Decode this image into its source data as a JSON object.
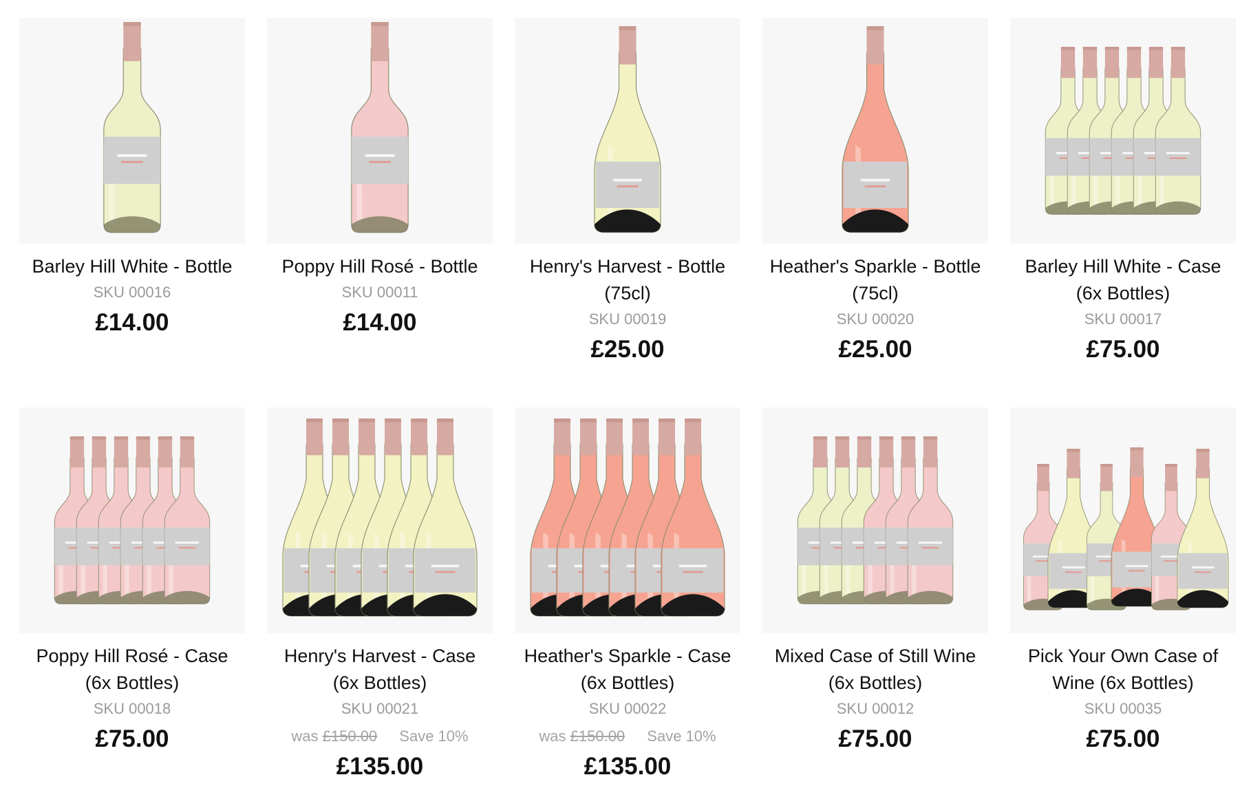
{
  "colors": {
    "white_wine": "#eef0c8",
    "rose_wine": "#f4c9c9",
    "sparkling_white": "#f2f2c2",
    "sparkling_rose": "#f6a491",
    "capsule": "#d6a9a2",
    "label": "#cfcfcf",
    "thumbnail_bg": "#f7f7f7",
    "sku_text": "#9a9a9a"
  },
  "products": [
    {
      "name": "Barley Hill White - Bottle",
      "sku": "SKU 00016",
      "price": "£14.00",
      "image": {
        "layout": "single",
        "style": "still",
        "wines": [
          "white"
        ]
      }
    },
    {
      "name": "Poppy Hill Rosé - Bottle",
      "sku": "SKU 00011",
      "price": "£14.00",
      "image": {
        "layout": "single",
        "style": "still",
        "wines": [
          "rose"
        ]
      }
    },
    {
      "name": "Henry's Harvest - Bottle (75cl)",
      "sku": "SKU 00019",
      "price": "£25.00",
      "image": {
        "layout": "single",
        "style": "sparkling",
        "wines": [
          "sparkling_white"
        ]
      }
    },
    {
      "name": "Heather's Sparkle - Bottle (75cl)",
      "sku": "SKU 00020",
      "price": "£25.00",
      "image": {
        "layout": "single",
        "style": "sparkling",
        "wines": [
          "sparkling_rose"
        ]
      }
    },
    {
      "name": "Barley Hill White - Case (6x Bottles)",
      "sku": "SKU 00017",
      "price": "£75.00",
      "image": {
        "layout": "row",
        "style": "still",
        "wines": [
          "white",
          "white",
          "white",
          "white",
          "white",
          "white"
        ]
      }
    },
    {
      "name": "Poppy Hill Rosé - Case (6x Bottles)",
      "sku": "SKU 00018",
      "price": "£75.00",
      "image": {
        "layout": "row",
        "style": "still",
        "wines": [
          "rose",
          "rose",
          "rose",
          "rose",
          "rose",
          "rose"
        ]
      }
    },
    {
      "name": "Henry's Harvest - Case (6x Bottles)",
      "sku": "SKU 00021",
      "was_label": "was",
      "was_price": "£150.00",
      "save_label": "Save 10%",
      "price": "£135.00",
      "image": {
        "layout": "row",
        "style": "sparkling",
        "wines": [
          "sparkling_white",
          "sparkling_white",
          "sparkling_white",
          "sparkling_white",
          "sparkling_white",
          "sparkling_white"
        ]
      }
    },
    {
      "name": "Heather's Sparkle - Case (6x Bottles)",
      "sku": "SKU 00022",
      "was_label": "was",
      "was_price": "£150.00",
      "save_label": "Save 10%",
      "price": "£135.00",
      "image": {
        "layout": "row",
        "style": "sparkling",
        "wines": [
          "sparkling_rose",
          "sparkling_rose",
          "sparkling_rose",
          "sparkling_rose",
          "sparkling_rose",
          "sparkling_rose"
        ]
      }
    },
    {
      "name": "Mixed Case of Still Wine (6x Bottles)",
      "sku": "SKU 00012",
      "price": "£75.00",
      "image": {
        "layout": "row",
        "style": "still",
        "wines": [
          "white",
          "white",
          "white",
          "rose",
          "rose",
          "rose"
        ]
      }
    },
    {
      "name": "Pick Your Own Case of Wine (6x Bottles)",
      "sku": "SKU 00035",
      "price": "£75.00",
      "image": {
        "layout": "mixed",
        "style": "mixed",
        "wines": [
          "rose",
          "sparkling_white",
          "white",
          "sparkling_rose",
          "rose",
          "sparkling_white"
        ]
      }
    }
  ]
}
